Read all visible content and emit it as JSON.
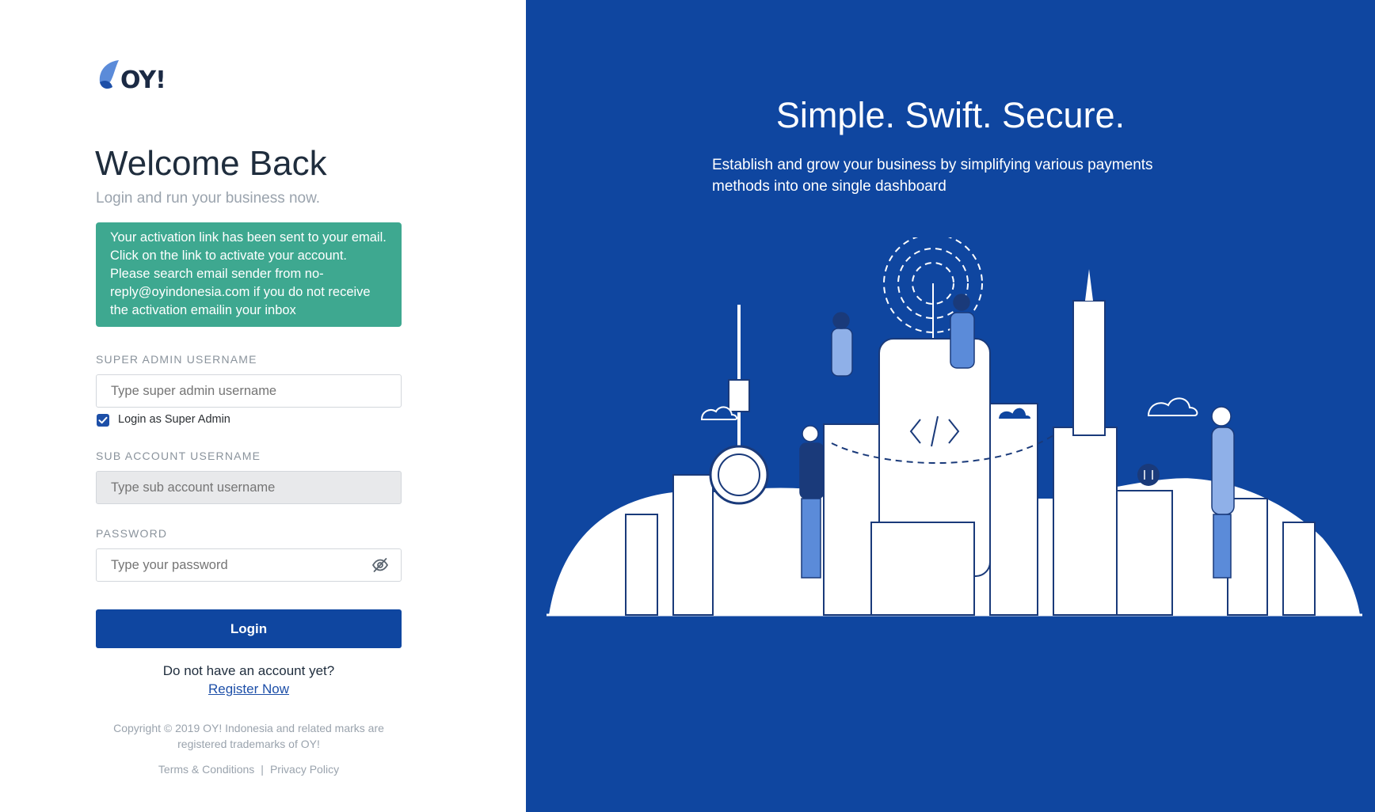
{
  "brand": {
    "name": "OY!"
  },
  "login": {
    "title": "Welcome Back",
    "subtitle": "Login and run your business now.",
    "alert": "Your activation link has been sent to your email. Click on the link to activate your account. Please search email sender from no-reply@oyindonesia.com if you do not receive the activation emailin your inbox",
    "super_admin": {
      "label": "SUPER ADMIN USERNAME",
      "placeholder": "Type super admin username",
      "value": ""
    },
    "super_admin_checkbox": {
      "label": "Login as Super Admin",
      "checked": true
    },
    "sub_account": {
      "label": "SUB ACCOUNT USERNAME",
      "placeholder": "Type sub account username",
      "value": "",
      "disabled": true
    },
    "password": {
      "label": "PASSWORD",
      "placeholder": "Type your password",
      "value": ""
    },
    "login_button": "Login",
    "no_account": "Do not have an account yet?",
    "register_link": "Register Now",
    "copyright": "Copyright © 2019 OY! Indonesia and related marks are registered trademarks of OY!",
    "terms": "Terms & Conditions",
    "separator": "|",
    "privacy": "Privacy Policy"
  },
  "hero": {
    "title": "Simple. Swift. Secure.",
    "description": "Establish and grow your business by simplifying various payments methods into one single dashboard"
  },
  "colors": {
    "primary": "#0f46a0",
    "alert_bg": "#3ea890",
    "text_dark": "#1f2d3d",
    "text_muted": "#9aa3ad"
  }
}
